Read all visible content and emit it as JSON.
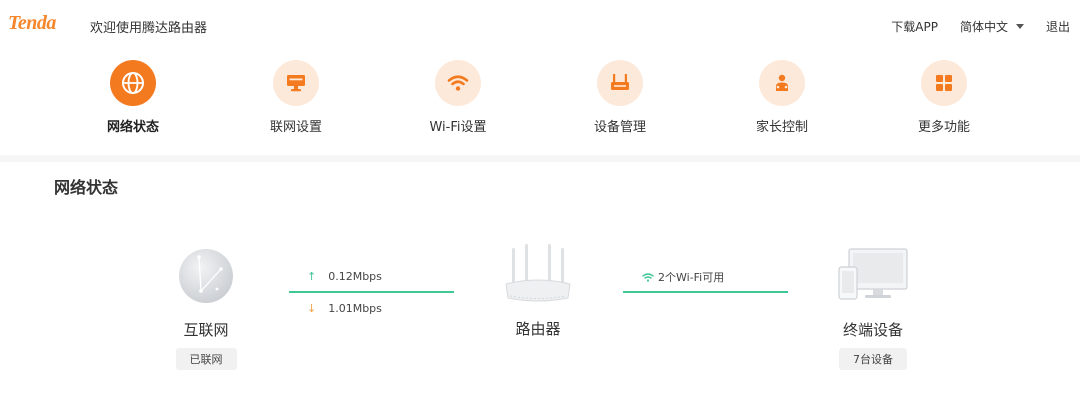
{
  "header": {
    "logo": "Tenda",
    "welcome": "欢迎使用腾达路由器",
    "download_app": "下载APP",
    "language": "简体中文",
    "logout": "退出"
  },
  "nav": {
    "items": [
      {
        "label": "网络状态",
        "icon": "globe-icon",
        "active": true
      },
      {
        "label": "联网设置",
        "icon": "monitor-icon",
        "active": false
      },
      {
        "label": "Wi-Fi设置",
        "icon": "wifi-icon",
        "active": false
      },
      {
        "label": "设备管理",
        "icon": "router-icon",
        "active": false
      },
      {
        "label": "家长控制",
        "icon": "parental-icon",
        "active": false
      },
      {
        "label": "更多功能",
        "icon": "grid-icon",
        "active": false
      }
    ]
  },
  "status": {
    "title": "网络状态",
    "internet": {
      "label": "互联网",
      "badge": "已联网"
    },
    "upload_speed": "0.12Mbps",
    "download_speed": "1.01Mbps",
    "router": {
      "label": "路由器"
    },
    "wifi_available": "2个Wi-Fi可用",
    "terminal": {
      "label": "终端设备",
      "badge": "7台设备"
    }
  },
  "colors": {
    "accent": "#f47a20",
    "accent_light": "#fde9da",
    "link_line": "#3fc796",
    "download_arrow": "#f5a342"
  }
}
